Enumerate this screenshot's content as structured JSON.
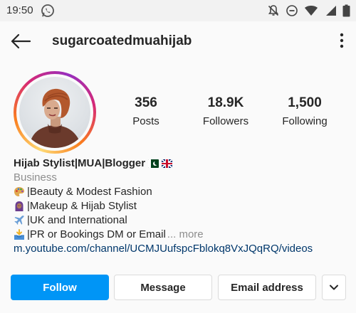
{
  "status_bar": {
    "time": "19:50",
    "icons": [
      "whatsapp-icon",
      "mute-icon",
      "dnd-icon",
      "wifi-icon",
      "signal-icon",
      "battery-icon"
    ]
  },
  "header": {
    "username": "sugarcoatedmuahijab",
    "back_icon": "arrow-left-icon",
    "more_icon": "more-vertical-icon"
  },
  "stats": [
    {
      "value": "356",
      "label": "Posts"
    },
    {
      "value": "18.9K",
      "label": "Followers"
    },
    {
      "value": "1,500",
      "label": "Following"
    }
  ],
  "bio": {
    "name": "Hijab Stylist|MUA|Blogger",
    "flags": [
      "pakistan-flag",
      "uk-flag"
    ],
    "category": "Business",
    "lines": [
      {
        "emoji": "palette-emoji",
        "text": "|Beauty & Modest Fashion"
      },
      {
        "emoji": "woman-headscarf-emoji",
        "text": "|Makeup & Hijab Stylist"
      },
      {
        "emoji": "airplane-emoji",
        "text": "|UK and International"
      },
      {
        "emoji": "inbox-tray-emoji",
        "text": "|PR or Bookings DM or Email"
      }
    ],
    "more": "... more",
    "link": "m.youtube.com/channel/UCMJUufspcFblokq8VxJQqRQ/videos"
  },
  "actions": {
    "follow": "Follow",
    "message": "Message",
    "email": "Email address",
    "dropdown_icon": "chevron-down-icon"
  },
  "colors": {
    "accent": "#0095f6",
    "link": "#00376b",
    "muted": "#8e8e8e"
  }
}
